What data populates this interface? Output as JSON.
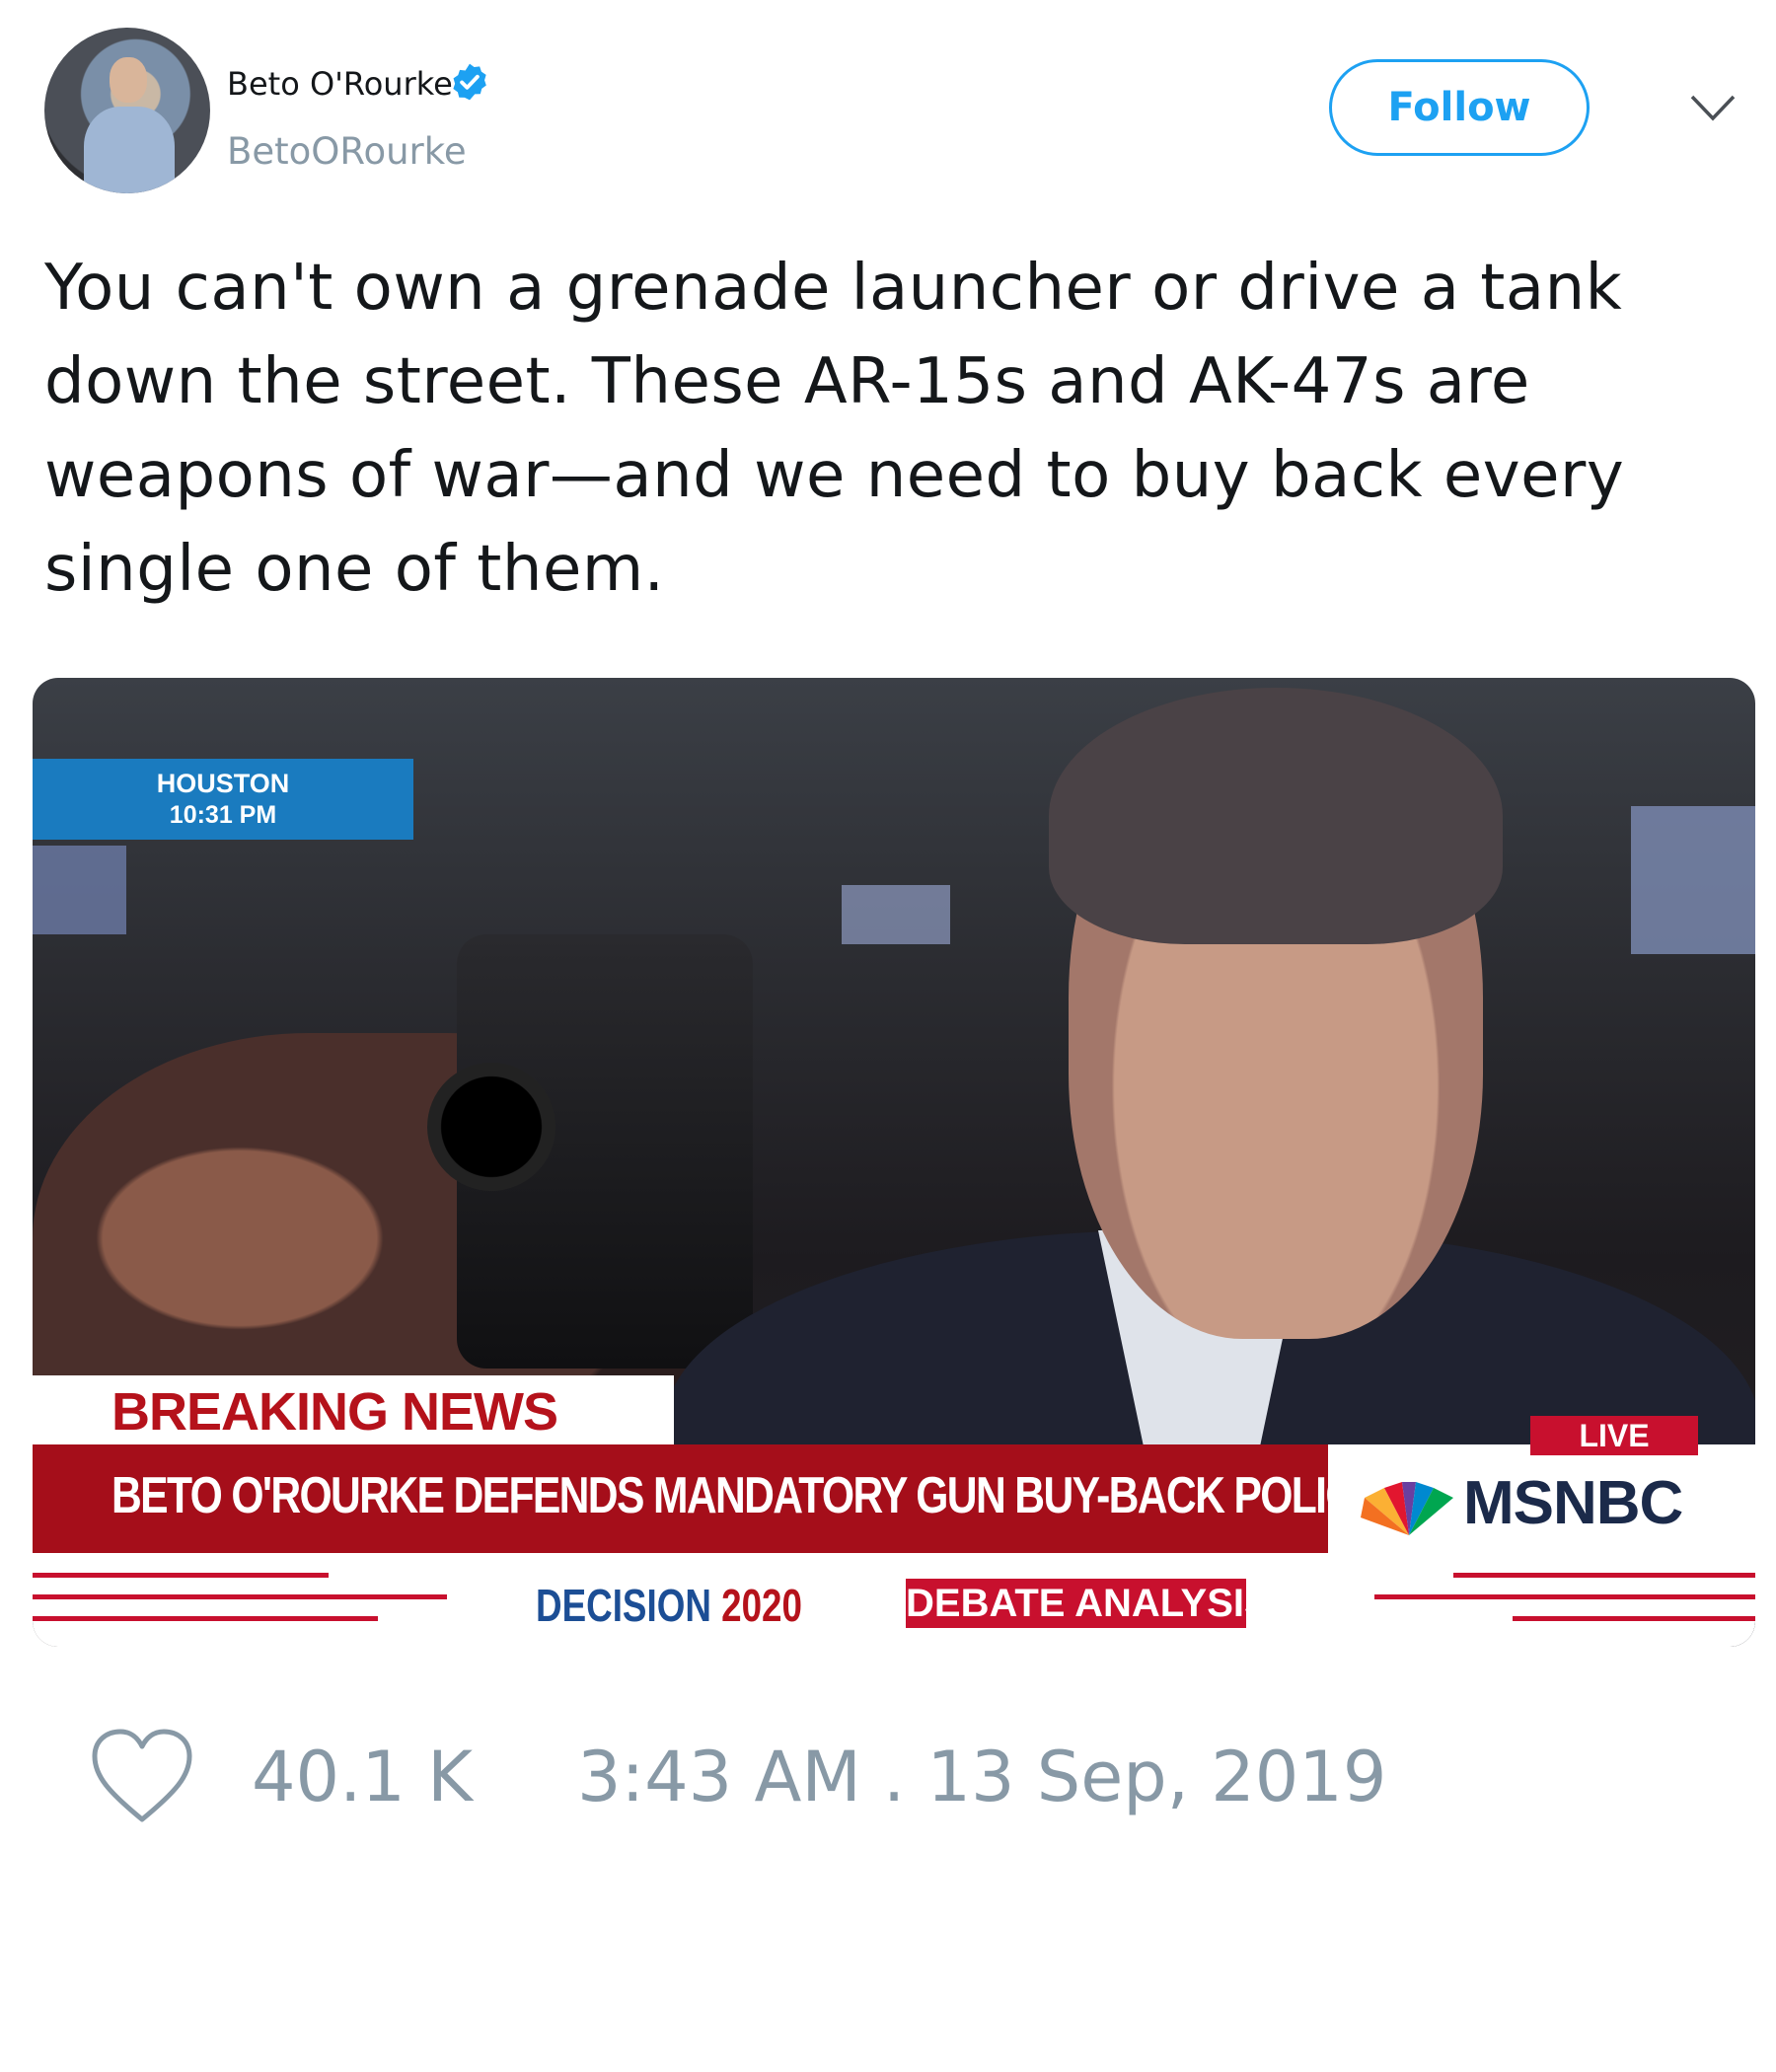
{
  "user": {
    "display_name": "Beto O'Rourke",
    "handle": "BetoORourke",
    "verified": true
  },
  "actions": {
    "follow_label": "Follow",
    "menu_icon": "chevron-down-icon"
  },
  "tweet": {
    "text": "You can't own a grenade launcher or drive a tank down the street. These AR-15s and AK-47s are weapons of war—and we need to buy back every single one of them."
  },
  "media": {
    "location": "HOUSTON",
    "time": "10:31 PM",
    "banner_label": "BREAKING NEWS",
    "headline": "BETO O'ROURKE DEFENDS MANDATORY GUN BUY-BACK POLICY",
    "live_label": "LIVE",
    "network": "MSNBC",
    "decision_prefix": "DECISION",
    "decision_year": "2020",
    "segment": "DEBATE ANALYSIS"
  },
  "footer": {
    "likes": "40.1 K",
    "timestamp": "3:43 AM . 13 Sep, 2019"
  },
  "colors": {
    "accent": "#1da1f2",
    "muted": "#8899a6",
    "breaking_red": "#a50e1a"
  }
}
